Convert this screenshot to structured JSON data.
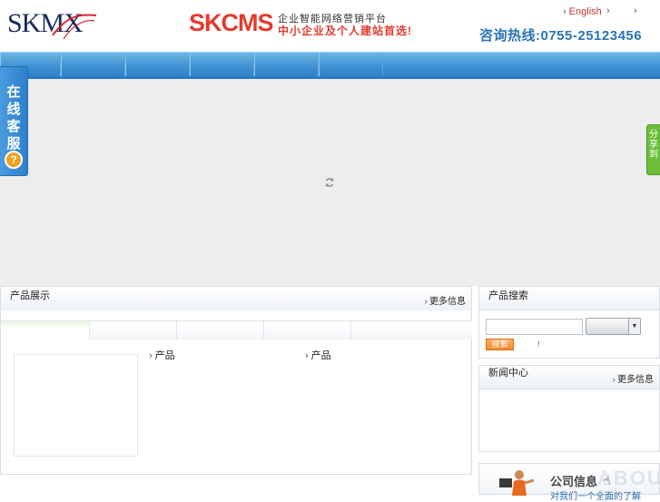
{
  "header": {
    "logo_text": "SKMX",
    "brand": "SKCMS",
    "tagline_1": "企业智能网络营销平台",
    "tagline_2": "中小企业及个人建站首选!",
    "hotline": "咨询热线:0755-25123456",
    "language_link": "English"
  },
  "nav": {
    "items": [
      "",
      "",
      "",
      "",
      "",
      ""
    ]
  },
  "float_left": {
    "label": "在线客服",
    "help_glyph": "?"
  },
  "float_right": {
    "label": "分享到"
  },
  "product_panel": {
    "title": "产品展示",
    "more_label": "更多信息",
    "links": [
      "产品",
      "产品"
    ]
  },
  "search_panel": {
    "title": "产品搜索",
    "input_value": "",
    "select_value": "",
    "button_label": "搜索",
    "note": "!"
  },
  "news_panel": {
    "title": "新闻中心",
    "more_label": "更多信息"
  },
  "company_panel": {
    "title": "公司信息",
    "subtitle": "对我们一个全面的了解",
    "watermark": "ABOUT"
  },
  "colors": {
    "nav_blue": "#3b8fd0",
    "brand_red": "#e23c2f",
    "hotline_blue": "#2a73b8",
    "stage_grey": "#ededed",
    "share_green": "#6cbe3a"
  }
}
